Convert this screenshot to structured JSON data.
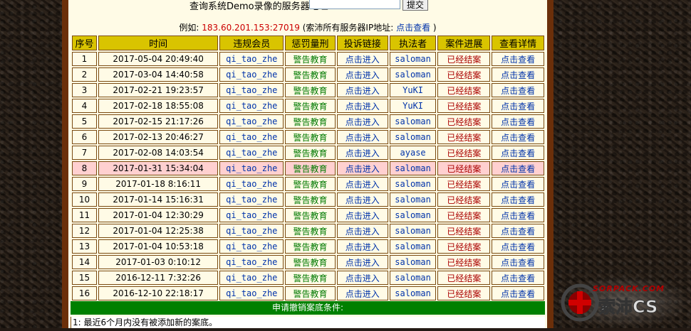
{
  "search": {
    "label": "查询系统Demo录像的服务器地址",
    "value": "",
    "submit_label": "提交"
  },
  "example": {
    "prefix": "例如:",
    "ip": "183.60.201.153:27019",
    "suffix": "(索沛所有服务器IP地址:",
    "link": "点击查看",
    "close": ")"
  },
  "table": {
    "headers": [
      "序号",
      "时间",
      "违规会员",
      "惩罚量刑",
      "投诉链接",
      "执法者",
      "案件进展",
      "查看详情"
    ],
    "rows": [
      {
        "num": "1",
        "time": "2017-05-04 20:49:40",
        "member": "qi_tao_zhe",
        "penalty": "警告教育",
        "link": "点击进入",
        "officer": "saloman",
        "progress": "已经结案",
        "detail": "点击查看"
      },
      {
        "num": "2",
        "time": "2017-03-04 14:40:58",
        "member": "qi_tao_zhe",
        "penalty": "警告教育",
        "link": "点击进入",
        "officer": "saloman",
        "progress": "已经结案",
        "detail": "点击查看"
      },
      {
        "num": "3",
        "time": "2017-02-21 19:23:57",
        "member": "qi_tao_zhe",
        "penalty": "警告教育",
        "link": "点击进入",
        "officer": "YuKI",
        "progress": "已经结案",
        "detail": "点击查看"
      },
      {
        "num": "4",
        "time": "2017-02-18 18:55:08",
        "member": "qi_tao_zhe",
        "penalty": "警告教育",
        "link": "点击进入",
        "officer": "YuKI",
        "progress": "已经结案",
        "detail": "点击查看"
      },
      {
        "num": "5",
        "time": "2017-02-15 21:17:26",
        "member": "qi_tao_zhe",
        "penalty": "警告教育",
        "link": "点击进入",
        "officer": "saloman",
        "progress": "已经结案",
        "detail": "点击查看"
      },
      {
        "num": "6",
        "time": "2017-02-13 20:46:27",
        "member": "qi_tao_zhe",
        "penalty": "警告教育",
        "link": "点击进入",
        "officer": "saloman",
        "progress": "已经结案",
        "detail": "点击查看"
      },
      {
        "num": "7",
        "time": "2017-02-08 14:03:54",
        "member": "qi_tao_zhe",
        "penalty": "警告教育",
        "link": "点击进入",
        "officer": "ayase",
        "progress": "已经结案",
        "detail": "点击查看"
      },
      {
        "num": "8",
        "time": "2017-01-31 15:34:04",
        "member": "qi_tao_zhe",
        "penalty": "警告教育",
        "link": "点击进入",
        "officer": "saloman",
        "progress": "已经结案",
        "detail": "点击查看"
      },
      {
        "num": "9",
        "time": "2017-01-18 8:16:11",
        "member": "qi_tao_zhe",
        "penalty": "警告教育",
        "link": "点击进入",
        "officer": "saloman",
        "progress": "已经结案",
        "detail": "点击查看"
      },
      {
        "num": "10",
        "time": "2017-01-14 15:16:31",
        "member": "qi_tao_zhe",
        "penalty": "警告教育",
        "link": "点击进入",
        "officer": "saloman",
        "progress": "已经结案",
        "detail": "点击查看"
      },
      {
        "num": "11",
        "time": "2017-01-04 12:30:29",
        "member": "qi_tao_zhe",
        "penalty": "警告教育",
        "link": "点击进入",
        "officer": "saloman",
        "progress": "已经结案",
        "detail": "点击查看"
      },
      {
        "num": "12",
        "time": "2017-01-04 12:25:38",
        "member": "qi_tao_zhe",
        "penalty": "警告教育",
        "link": "点击进入",
        "officer": "saloman",
        "progress": "已经结案",
        "detail": "点击查看"
      },
      {
        "num": "13",
        "time": "2017-01-04 10:53:18",
        "member": "qi_tao_zhe",
        "penalty": "警告教育",
        "link": "点击进入",
        "officer": "saloman",
        "progress": "已经结案",
        "detail": "点击查看"
      },
      {
        "num": "14",
        "time": "2017-01-03 0:10:12",
        "member": "qi_tao_zhe",
        "penalty": "警告教育",
        "link": "点击进入",
        "officer": "saloman",
        "progress": "已经结案",
        "detail": "点击查看"
      },
      {
        "num": "15",
        "time": "2016-12-11 7:32:26",
        "member": "qi_tao_zhe",
        "penalty": "警告教育",
        "link": "点击进入",
        "officer": "saloman",
        "progress": "已经结案",
        "detail": "点击查看"
      },
      {
        "num": "16",
        "time": "2016-12-10 22:18:17",
        "member": "qi_tao_zhe",
        "penalty": "警告教育",
        "link": "点击进入",
        "officer": "saloman",
        "progress": "已经结案",
        "detail": "点击查看"
      }
    ],
    "highlighted_row": 8
  },
  "apply": {
    "title": "申请撤销案底条件:",
    "condition_1": "1: 最近6个月内没有被添加新的案底。"
  },
  "watermark": {
    "text": "SORPACK.COM",
    "brand": "索沛CS"
  },
  "colors": {
    "header_bg": "#d9c400",
    "frame": "#6b2f0a",
    "content_bg": "#fffbe6",
    "highlight_row": "#ffd0d0",
    "apply_bar": "#008000",
    "link_blue": "#0033aa",
    "penalty_green": "#007a00",
    "progress_red": "#aa0000"
  }
}
